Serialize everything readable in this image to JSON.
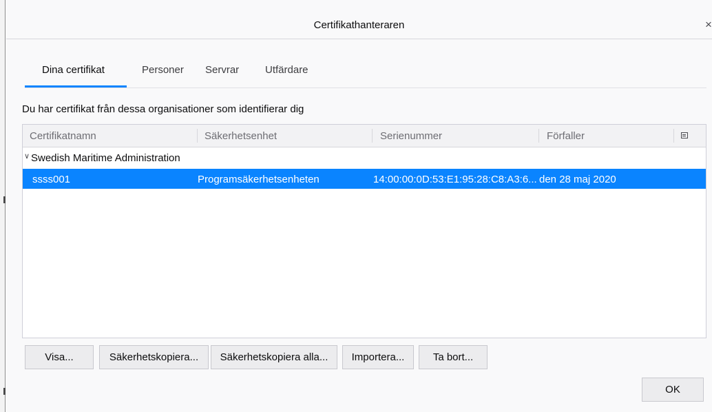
{
  "window": {
    "title": "Certifikathanteraren",
    "close_glyph": "×"
  },
  "tabs": [
    {
      "label": "Dina certifikat",
      "active": true
    },
    {
      "label": "Personer",
      "active": false
    },
    {
      "label": "Servrar",
      "active": false
    },
    {
      "label": "Utfärdare",
      "active": false
    }
  ],
  "description": "Du har certifikat från dessa organisationer som identifierar dig",
  "table": {
    "columns": [
      "Certifikatnamn",
      "Säkerhetsenhet",
      "Serienummer",
      "Förfaller"
    ],
    "column_picker_icon": "column-picker-icon",
    "groups": [
      {
        "name": "Swedish Maritime Administration",
        "expanded": true,
        "rows": [
          {
            "certificate_name": "ssss001",
            "security_device": "Programsäkerhetsenheten",
            "serial_number": "14:00:00:0D:53:E1:95:28:C8:A3:6...",
            "expires": "den 28 maj 2020",
            "selected": true
          }
        ]
      }
    ]
  },
  "buttons": {
    "view": "Visa...",
    "backup": "Säkerhetskopiera...",
    "backup_all": "Säkerhetskopiera alla...",
    "import": "Importera...",
    "delete": "Ta bort...",
    "ok": "OK"
  },
  "colors": {
    "accent": "#0a84ff",
    "background": "#f9f9fa",
    "selection_text": "#ffffff"
  }
}
